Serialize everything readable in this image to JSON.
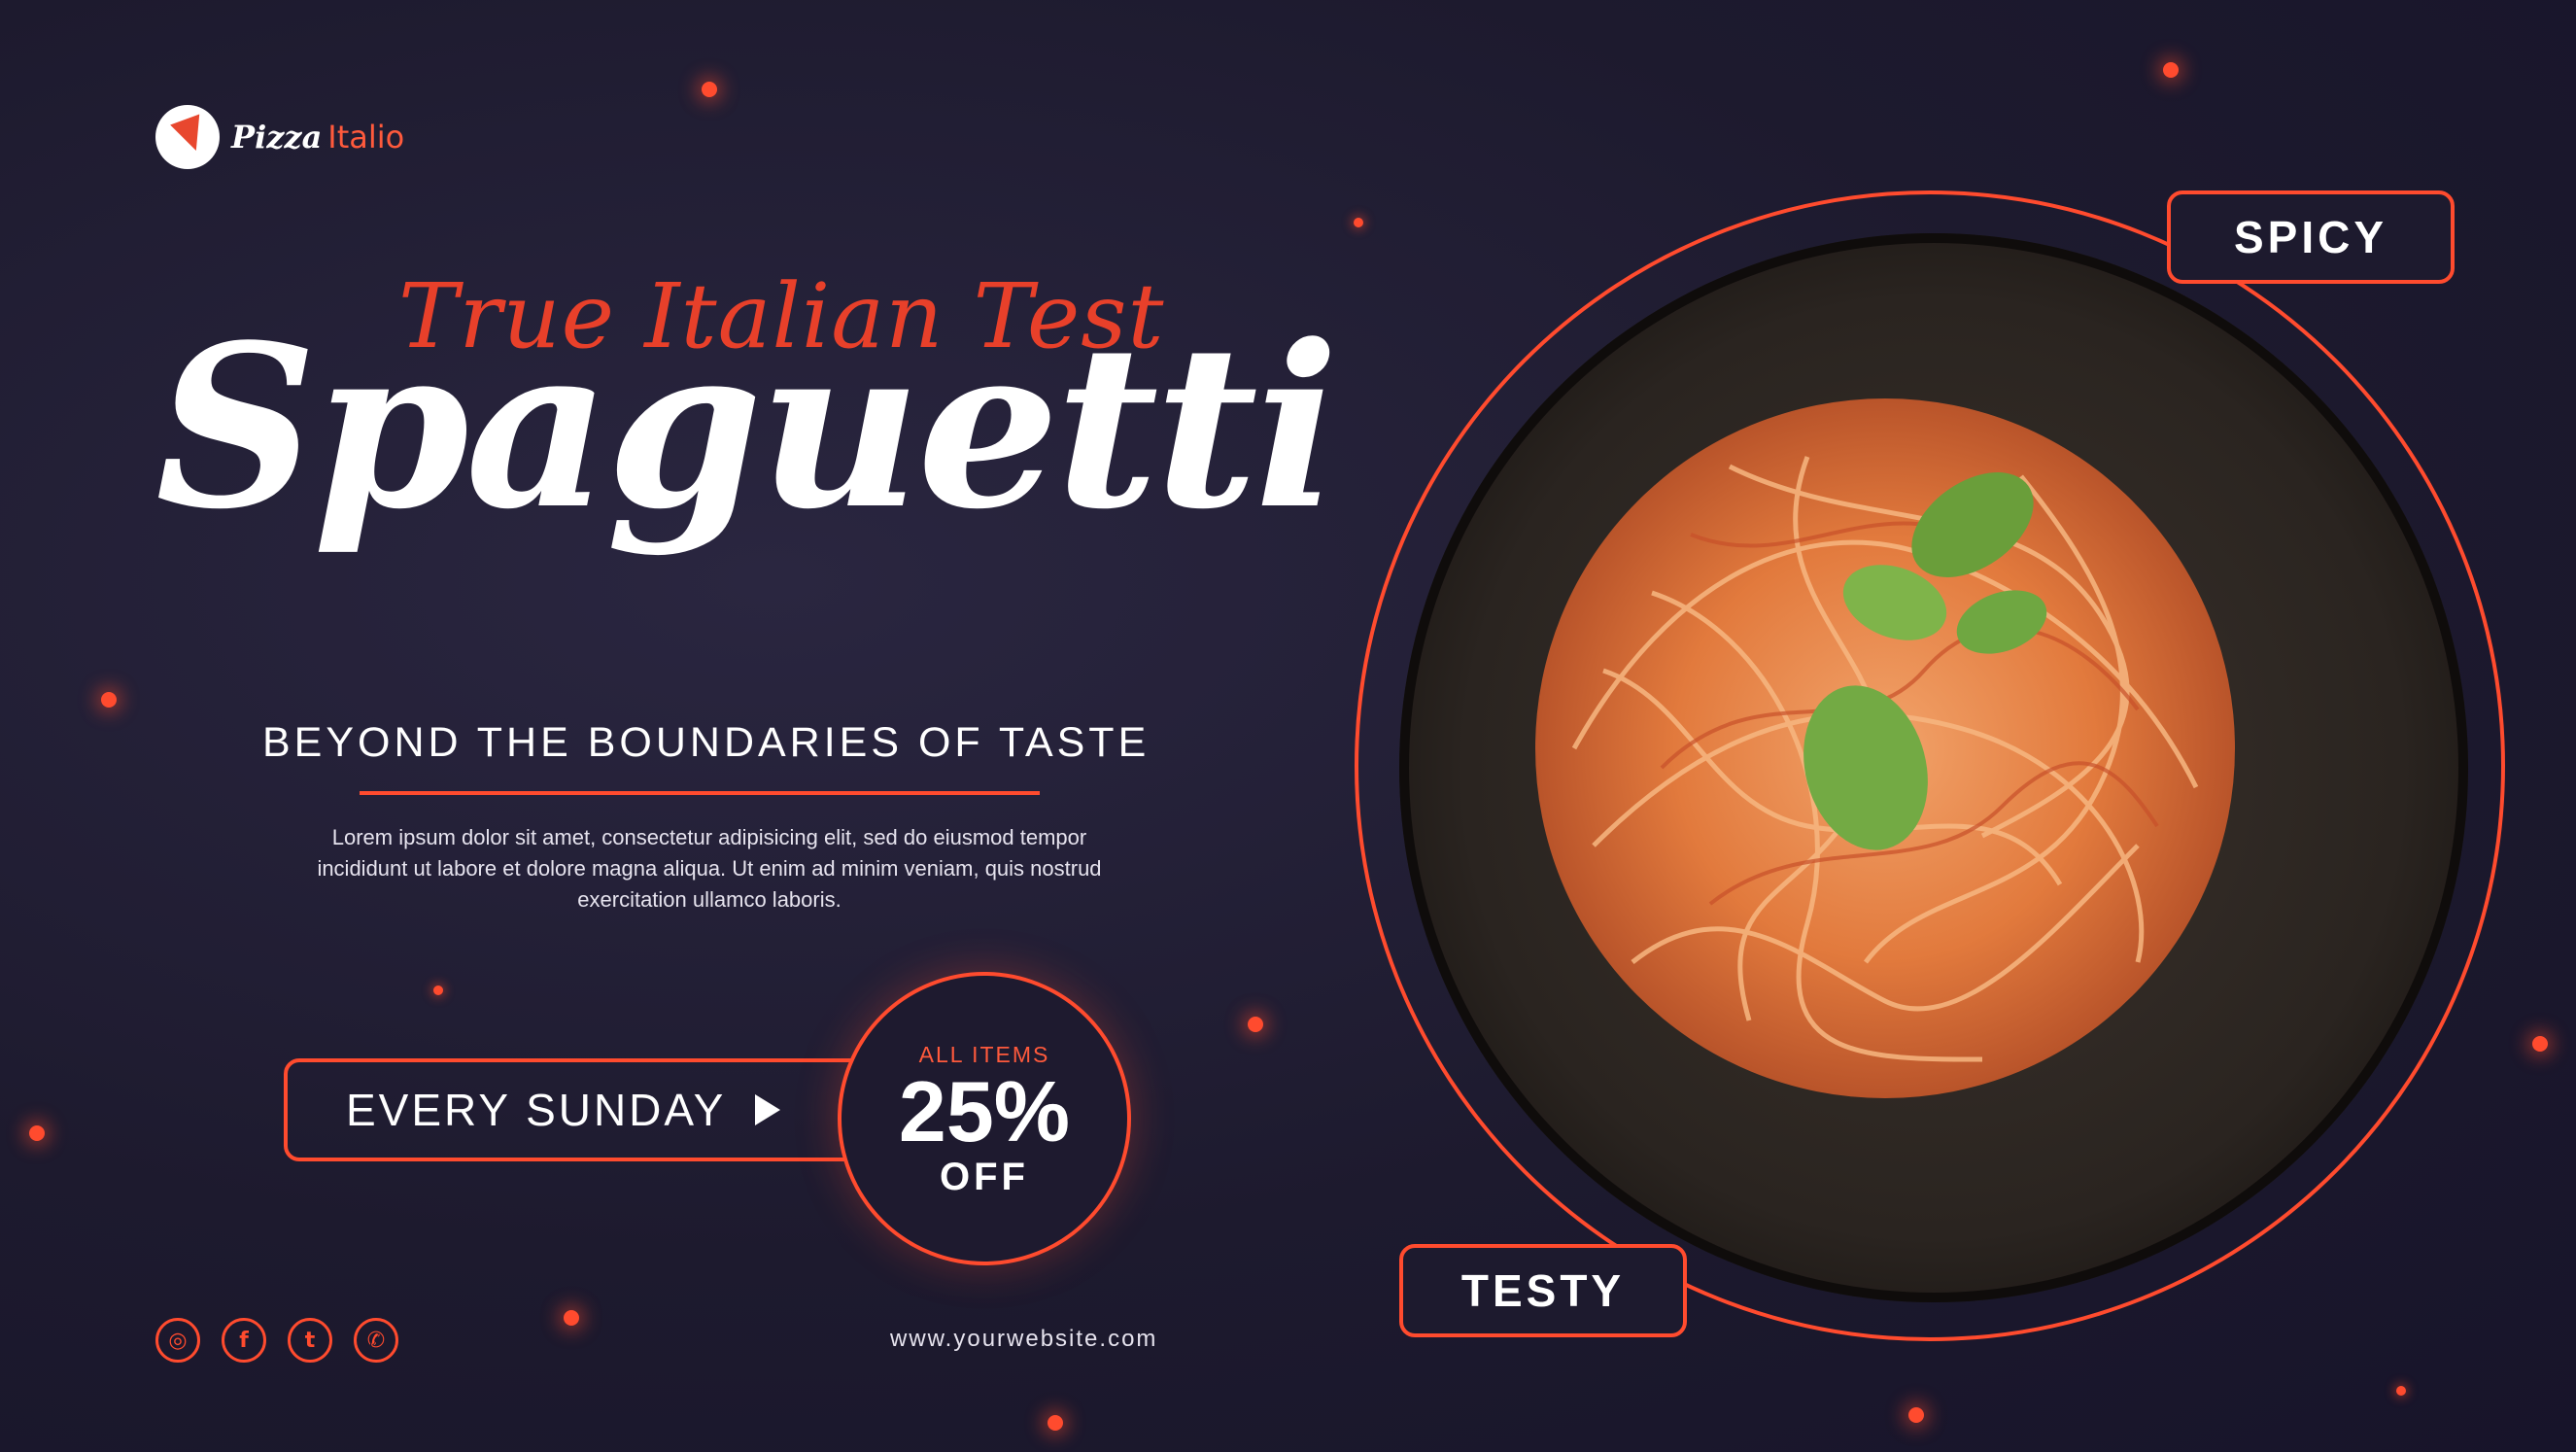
{
  "brand": {
    "name_part1": "Pizza",
    "name_part2": "Italio",
    "accent_color": "#ff4b2e"
  },
  "hero": {
    "script_title": "True Italian Test",
    "main_title": "Spaguetti",
    "tagline": "BEYOND THE BOUNDARIES OF TASTE",
    "description": "Lorem ipsum dolor sit amet, consectetur adipisicing elit, sed do eiusmod tempor incididunt ut labore et dolore magna aliqua. Ut enim ad minim veniam, quis nostrud exercitation ullamco laboris."
  },
  "offer": {
    "schedule_label": "EVERY SUNDAY",
    "discount_top": "ALL ITEMS",
    "discount_value": "25%",
    "discount_bottom": "OFF"
  },
  "socials": [
    {
      "icon": "instagram-icon",
      "glyph": "◎"
    },
    {
      "icon": "facebook-icon",
      "glyph": "f"
    },
    {
      "icon": "twitter-icon",
      "glyph": "t"
    },
    {
      "icon": "whatsapp-icon",
      "glyph": "✆"
    }
  ],
  "footer": {
    "website": "www.yourwebsite.com"
  },
  "badges": {
    "top": "SPICY",
    "bottom": "TESTY"
  }
}
